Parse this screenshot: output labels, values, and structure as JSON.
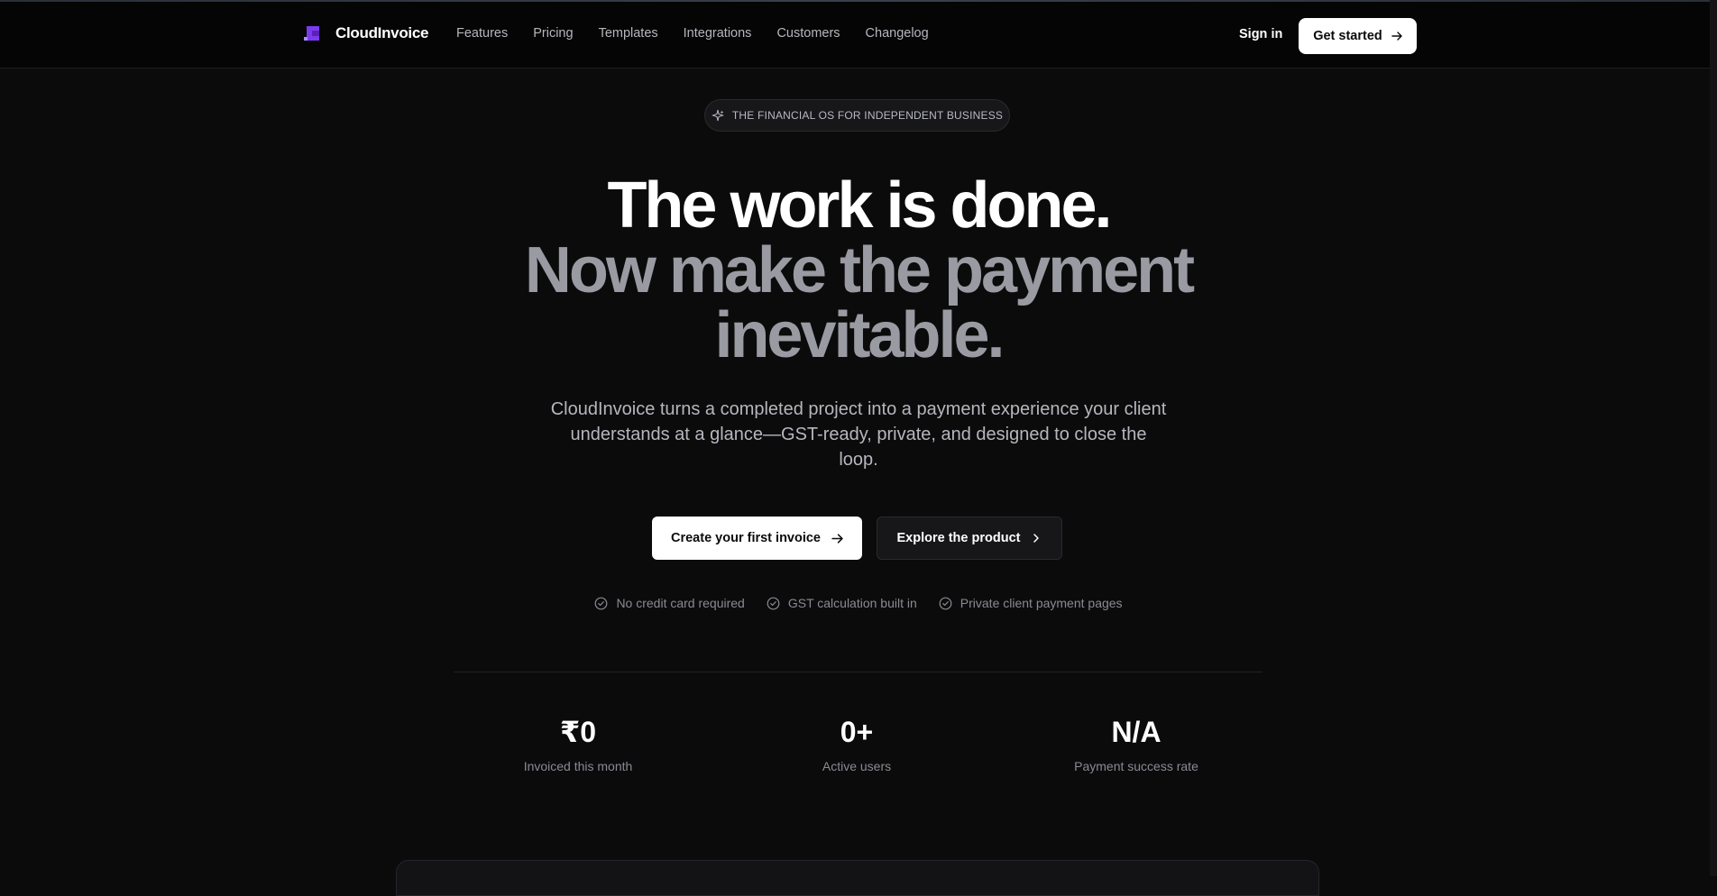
{
  "header": {
    "brand": "CloudInvoice",
    "nav": [
      "Features",
      "Pricing",
      "Templates",
      "Integrations",
      "Customers",
      "Changelog"
    ],
    "sign_in": "Sign in",
    "get_started": "Get started"
  },
  "hero": {
    "badge": "THE FINANCIAL OS FOR INDEPENDENT BUSINESS",
    "headline_1": "The work is done.",
    "headline_2": "Now make the payment",
    "headline_3": "inevitable.",
    "subtitle": "CloudInvoice turns a completed project into a payment experience your client understands at a glance—GST-ready, private, and designed to close the loop.",
    "primary_cta": "Create your first invoice",
    "secondary_cta": "Explore the product",
    "checks": [
      "No credit card required",
      "GST calculation built in",
      "Private client payment pages"
    ]
  },
  "stats": [
    {
      "value": "₹0",
      "label": "Invoiced this month"
    },
    {
      "value": "0+",
      "label": "Active users"
    },
    {
      "value": "N/A",
      "label": "Payment success rate"
    }
  ],
  "colors": {
    "background": "#0b0b0c",
    "header_bg": "#050506",
    "brand_accent": "#7c3aed",
    "muted_headline": "#9a9aa2",
    "muted_text": "#8a8a92"
  },
  "icons": {
    "logo": "cloudinvoice-logo-icon",
    "badge": "sparkle-icon",
    "cta_arrow": "arrow-right-icon",
    "secondary_chevron": "chevron-right-icon",
    "check": "check-circle-icon"
  }
}
